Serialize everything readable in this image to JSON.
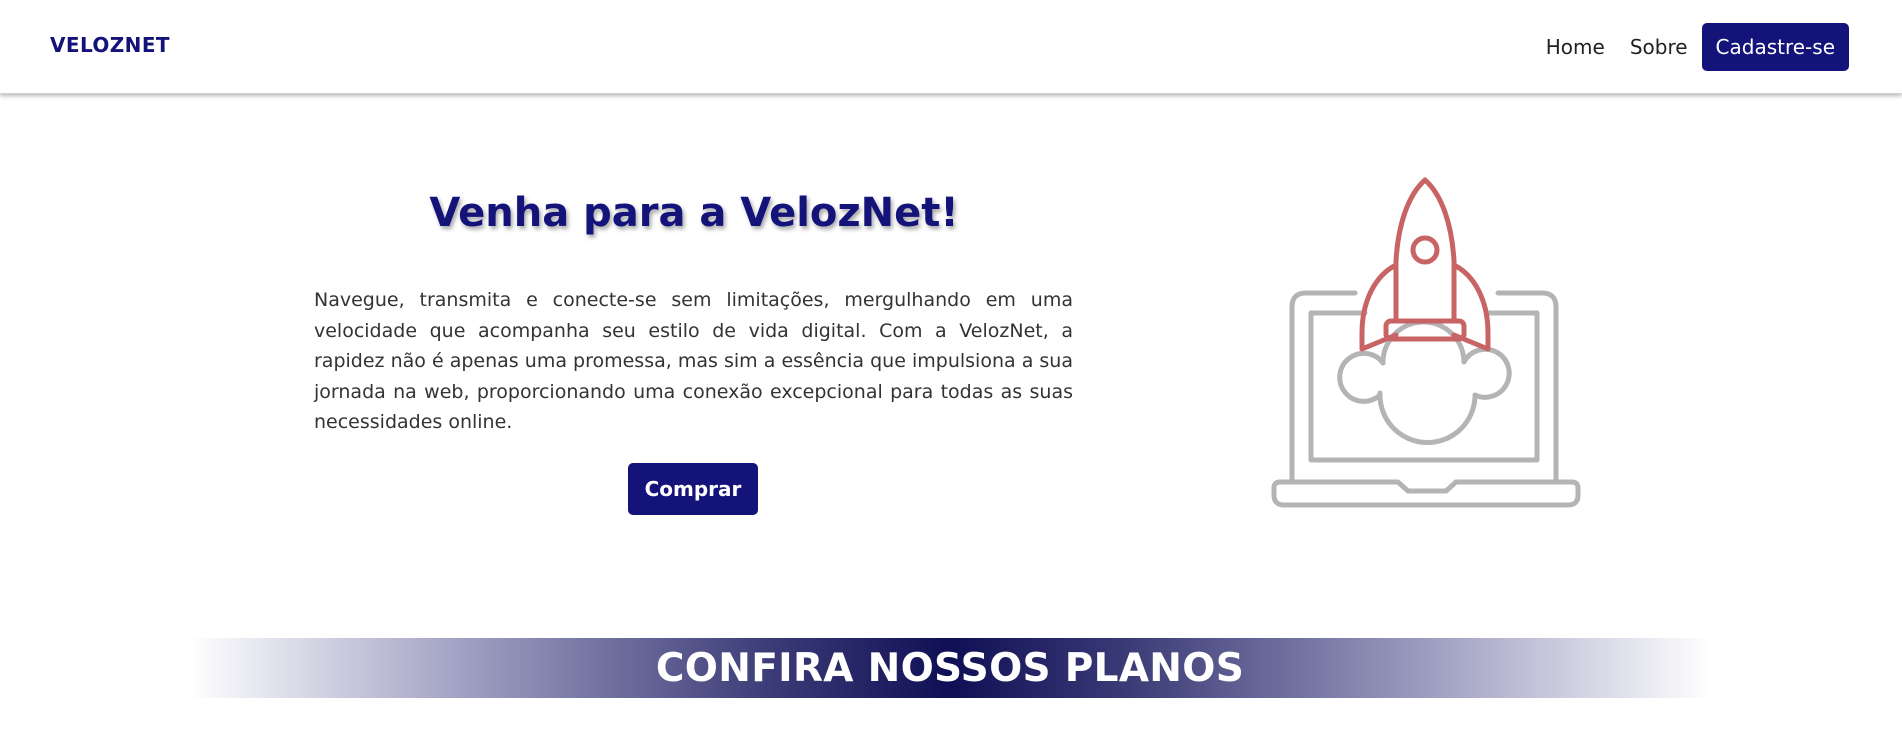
{
  "navbar": {
    "brand": "VELOZNET",
    "links": [
      "Home",
      "Sobre"
    ],
    "cta_label": "Cadastre-se"
  },
  "hero": {
    "title": "Venha para a VelozNet!",
    "description": "Navegue, transmita e conecte-se sem limitações, mergulhando em uma velocidade que acompanha seu estilo de vida digital. Com a VelozNet, a rapidez não é apenas uma promessa, mas sim a essência que impulsiona a sua jornada na web, proporcionando uma conexão excepcional para todas as suas necessidades online.",
    "buy_label": "Comprar",
    "illustration_icon": "laptop-rocket-icon"
  },
  "plans": {
    "title": "CONFIRA NOSSOS PLANOS"
  },
  "colors": {
    "brand": "#13137a",
    "rocket": "#c86464",
    "laptop": "#b4b4b4"
  }
}
